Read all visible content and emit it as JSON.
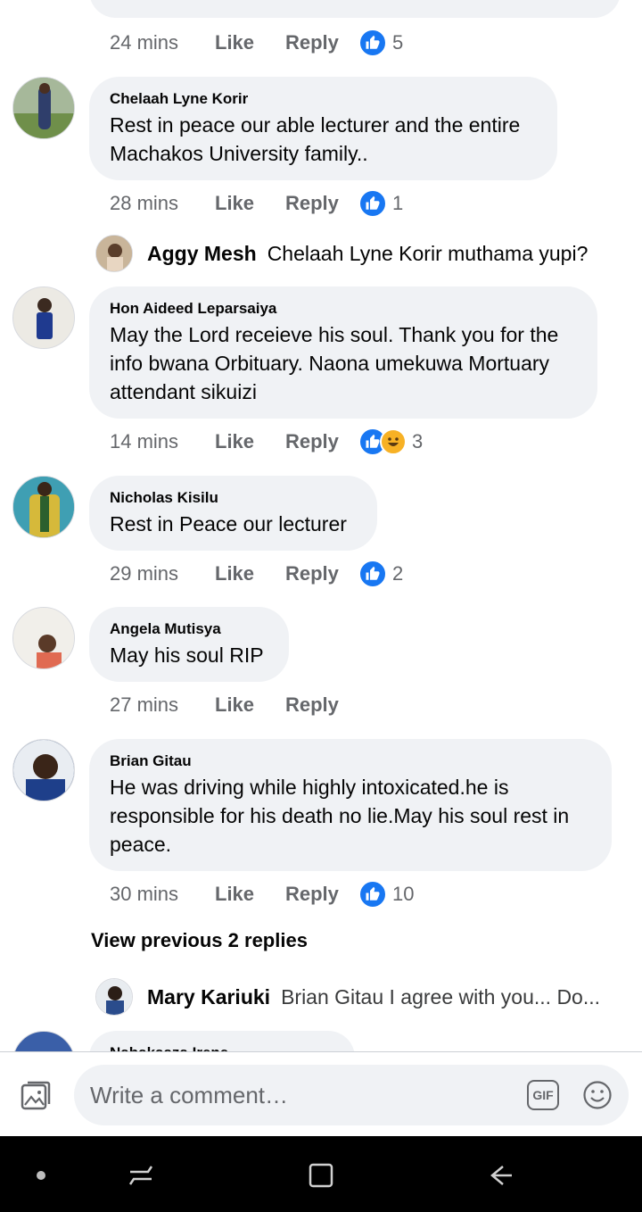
{
  "comments": [
    {
      "time": "24 mins",
      "like": "Like",
      "reply": "Reply",
      "reactions": "5"
    },
    {
      "name": "Chelaah Lyne Korir",
      "text": "Rest in peace our able lecturer and the entire Machakos University family..",
      "time": "28 mins",
      "like": "Like",
      "reply": "Reply",
      "reactions": "1"
    },
    {
      "name": "Hon Aideed Leparsaiya",
      "text": "May the Lord receieve his soul. Thank you for the info bwana Orbituary. Naona umekuwa Mortuary attendant sikuizi",
      "time": "14 mins",
      "like": "Like",
      "reply": "Reply",
      "reactions": "3"
    },
    {
      "name": "Nicholas Kisilu",
      "text": "Rest in Peace our lecturer",
      "time": "29 mins",
      "like": "Like",
      "reply": "Reply",
      "reactions": "2"
    },
    {
      "name": "Angela Mutisya",
      "text": "May his soul RIP",
      "time": "27 mins",
      "like": "Like",
      "reply": "Reply"
    },
    {
      "name": "Brian Gitau",
      "text": "He was driving while highly intoxicated.he is responsible for his death no lie.May his soul rest in peace.",
      "time": "30 mins",
      "like": "Like",
      "reply": "Reply",
      "reactions": "10"
    }
  ],
  "replies": [
    {
      "name": "Aggy Mesh",
      "text": "Chelaah Lyne Korir muthama yupi?"
    },
    {
      "name": "Mary Kariuki",
      "text": "Brian Gitau I agree with you... Do..."
    }
  ],
  "view_previous": "View previous 2 replies",
  "partial_name": "Nabakaaza Irene",
  "composer": {
    "placeholder": "Write a comment…",
    "gif_label": "GIF"
  },
  "colors": {
    "like_blue": "#1877f2",
    "bubble_bg": "#f0f2f5",
    "meta_gray": "#65676b"
  }
}
